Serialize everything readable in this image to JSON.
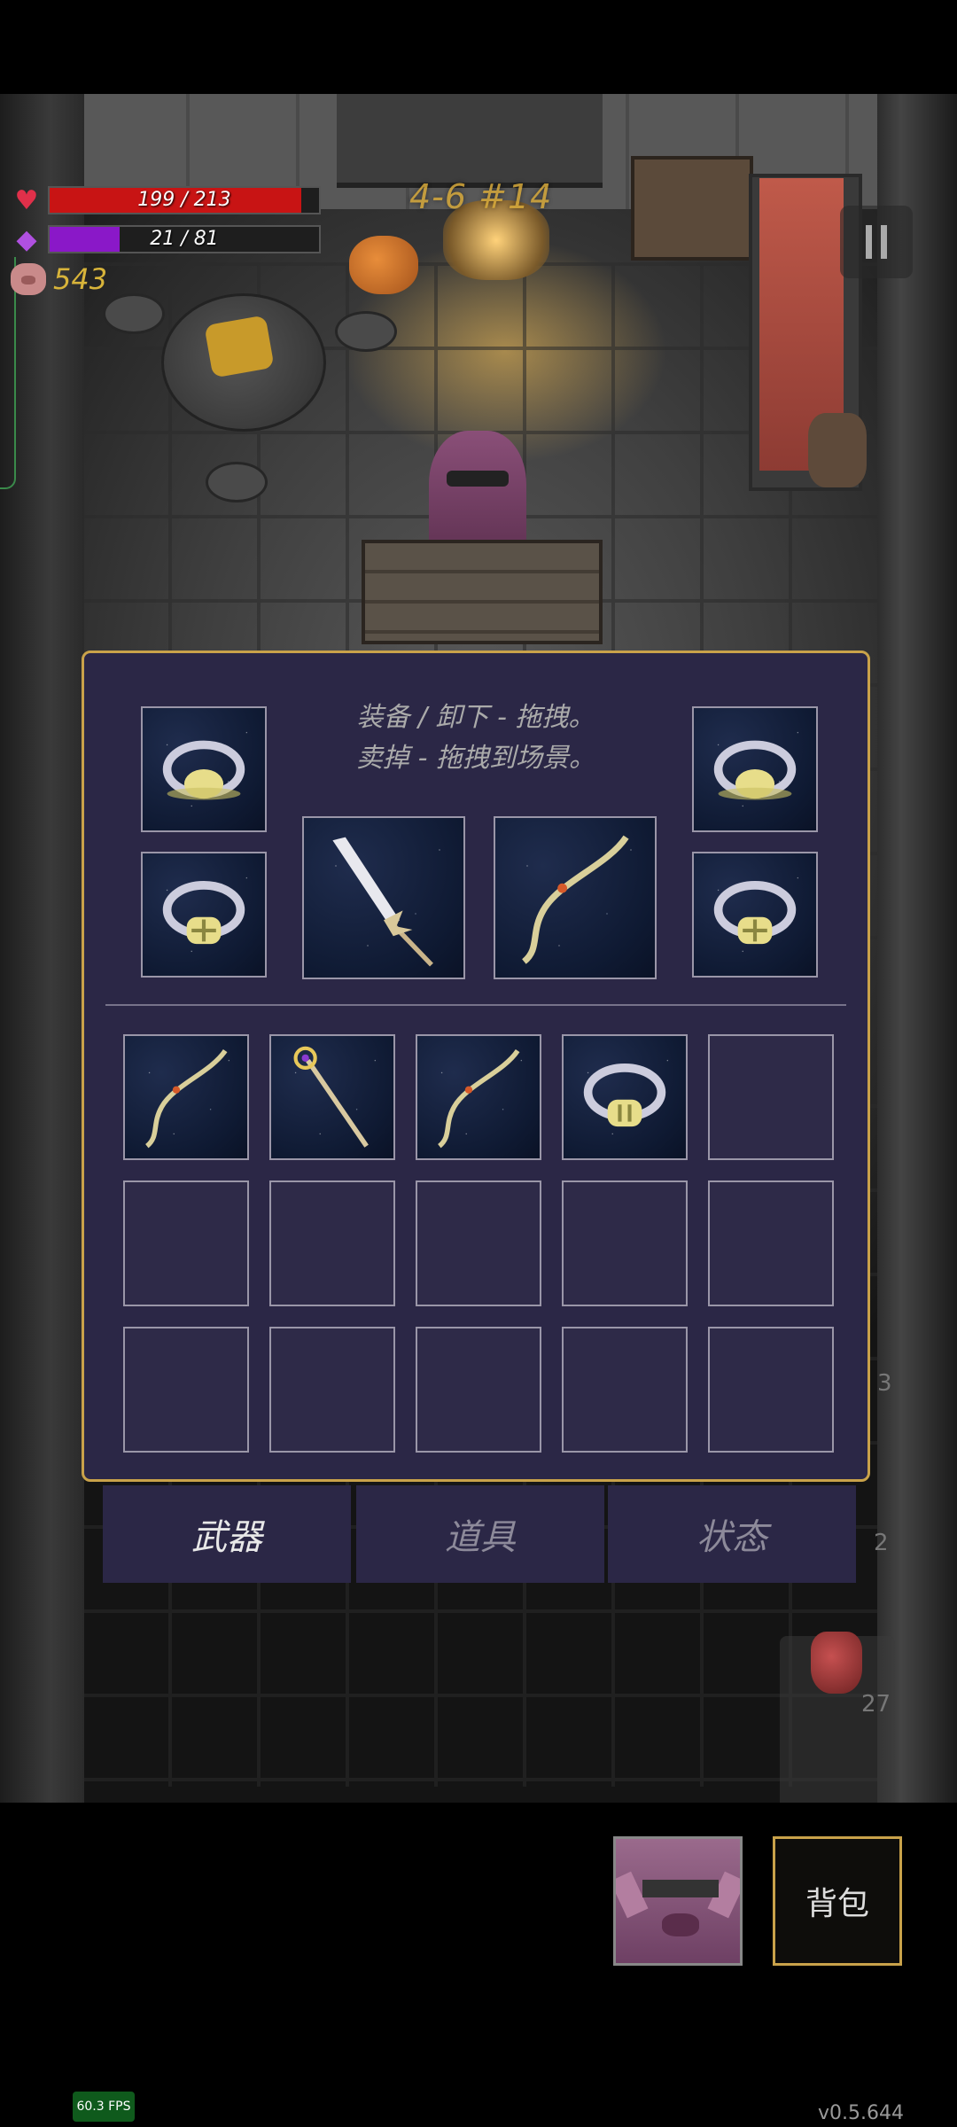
{
  "hud": {
    "hp": {
      "text": "199 / 213",
      "fraction": 0.934,
      "color": "#c81414",
      "icon": "heart-icon"
    },
    "mp": {
      "text": "21 / 81",
      "fraction": 0.26,
      "color": "#8a18c8",
      "icon": "mana-crystal-icon"
    },
    "gold": {
      "value": "543",
      "icon": "pig-coin-icon"
    },
    "floor_label": "4-6 #14"
  },
  "inventory": {
    "hint_line1": "装备 / 卸下 - 拖拽。",
    "hint_line2": "卖掉 - 拖拽到场景。",
    "equipped": [
      {
        "slot": "ring-top-left",
        "item": "ring"
      },
      {
        "slot": "ring-top-right",
        "item": "ring"
      },
      {
        "slot": "ring-bottom-left",
        "item": "ring"
      },
      {
        "slot": "ring-bottom-right",
        "item": "ring"
      },
      {
        "slot": "weapon-main",
        "item": "spear"
      },
      {
        "slot": "weapon-off",
        "item": "bow"
      }
    ],
    "bag": [
      "bow",
      "staff",
      "bow",
      "ring",
      "",
      "",
      "",
      "",
      "",
      "",
      "",
      "",
      "",
      "",
      ""
    ]
  },
  "tabs": [
    {
      "label": "武器",
      "active": true
    },
    {
      "label": "道具",
      "active": false
    },
    {
      "label": "状态",
      "active": false
    }
  ],
  "scene_numbers": {
    "a": "3",
    "b": "2",
    "potion_count": "27"
  },
  "bottom": {
    "bag_label": "背包"
  },
  "footer": {
    "fps": "60.3 FPS",
    "version": "v0.5.644"
  },
  "colors": {
    "panel_bg": "#2b2746",
    "panel_border": "#c9a24a",
    "gold": "#d8b43a"
  }
}
